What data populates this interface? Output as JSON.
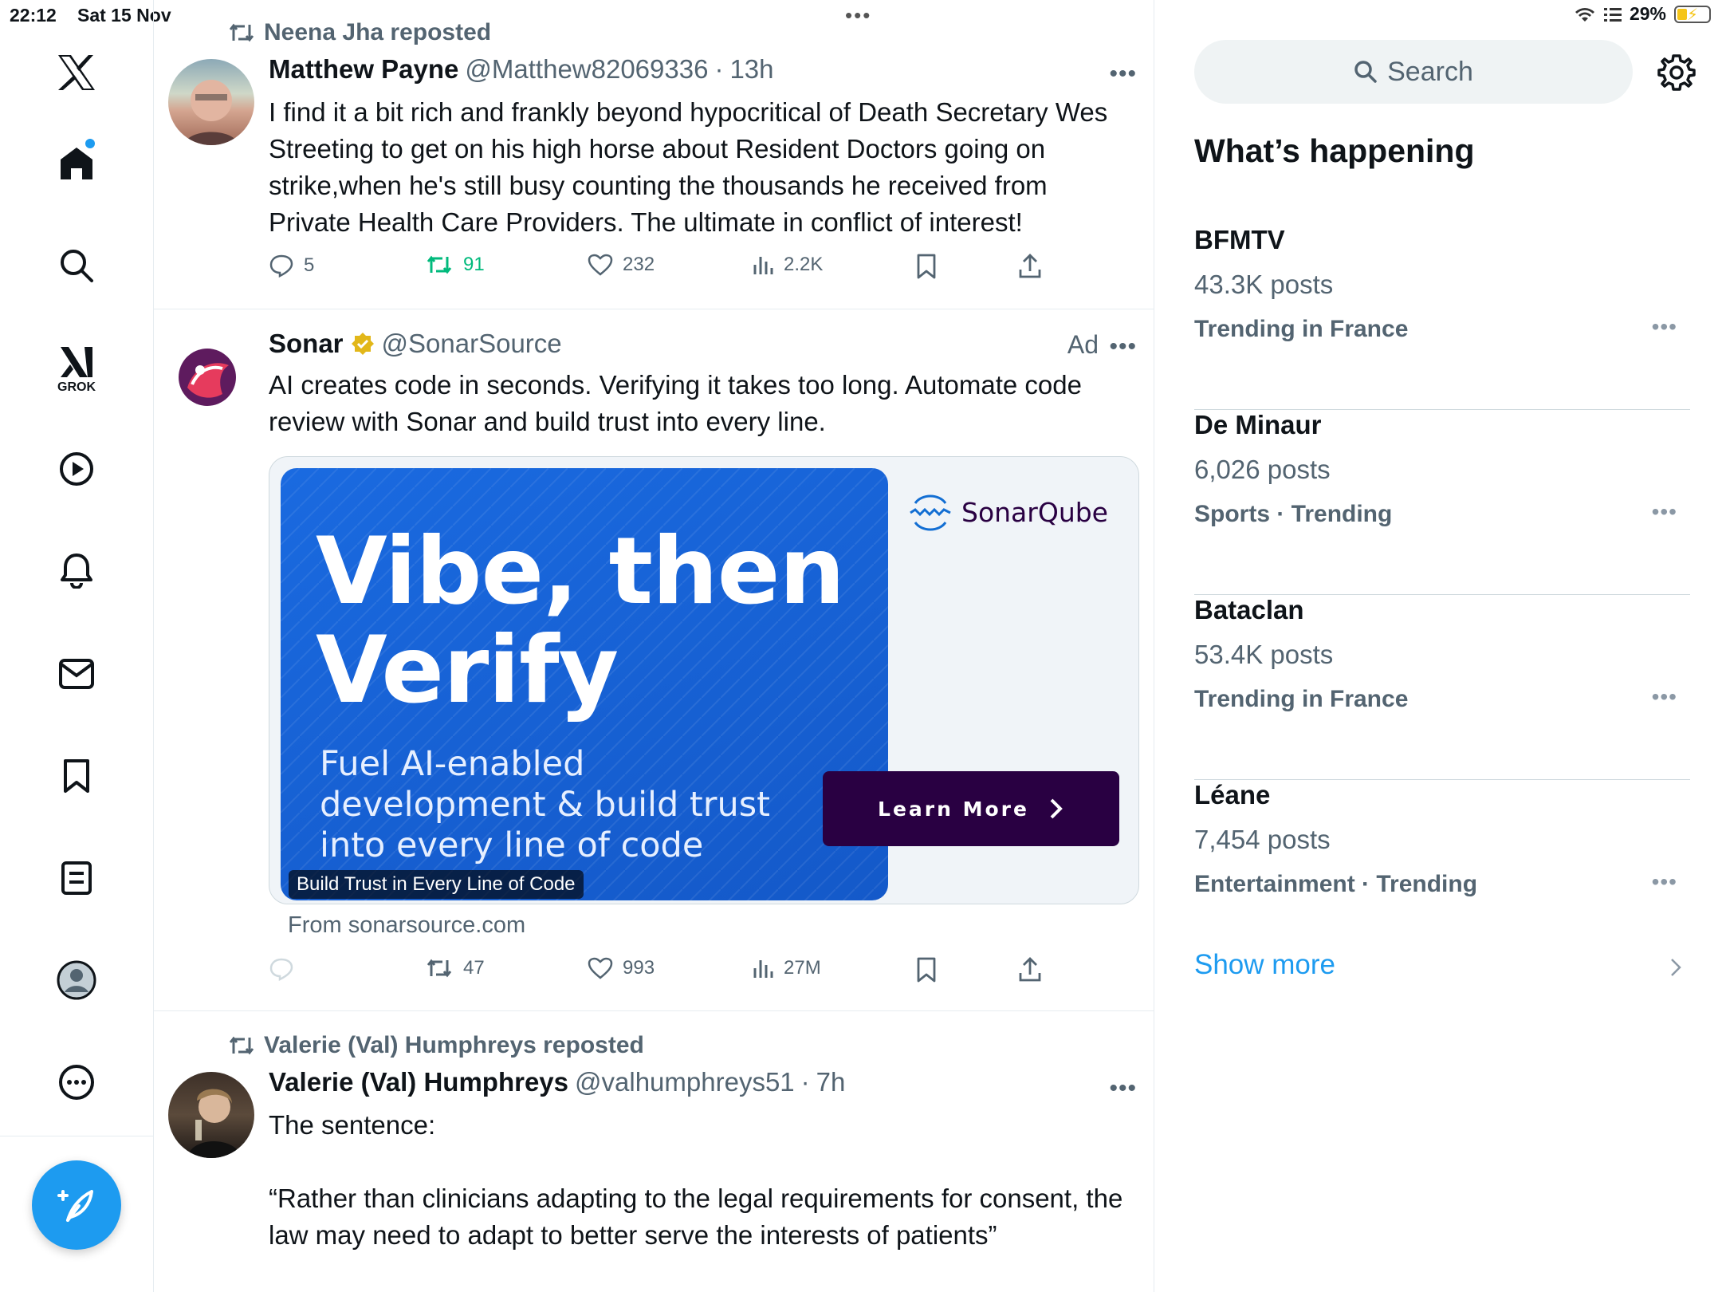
{
  "status_bar": {
    "time": "22:12",
    "date": "Sat 15 Nov",
    "battery": "29%"
  },
  "nav": {
    "items": [
      {
        "name": "x-logo"
      },
      {
        "name": "home"
      },
      {
        "name": "explore"
      },
      {
        "name": "grok",
        "label": "GROK"
      },
      {
        "name": "video"
      },
      {
        "name": "notifications"
      },
      {
        "name": "messages"
      },
      {
        "name": "bookmarks"
      },
      {
        "name": "lists"
      },
      {
        "name": "profile"
      },
      {
        "name": "more"
      }
    ],
    "compose_icon": "compose-icon"
  },
  "feed": {
    "posts": [
      {
        "reposted_by": "Neena Jha reposted",
        "name": "Matthew Payne",
        "handle": "@Matthew82069336",
        "time": "13h",
        "text": "I find it a bit rich and frankly beyond hypocritical of Death Secretary Wes Streeting to get on his high horse about Resident Doctors going on strike,when he's still busy counting the thousands he received from Private Health Care Providers. The ultimate in conflict of interest!",
        "replies": "5",
        "reposts": "91",
        "likes": "232",
        "views": "2.2K"
      },
      {
        "name": "Sonar",
        "handle": "@SonarSource",
        "ad_label": "Ad",
        "text": "AI creates code in seconds. Verifying it takes too long. Automate code review with Sonar and build trust into every line.",
        "card": {
          "headline_1": "Vibe, then",
          "headline_2": "Verify",
          "subtext": "Fuel AI-enabled development & build trust into every line of code",
          "caption": "Build Trust in Every Line of Code",
          "brand": "SonarQube",
          "cta": "Learn More"
        },
        "from": "From sonarsource.com",
        "replies": "",
        "reposts": "47",
        "likes": "993",
        "views": "27M"
      },
      {
        "reposted_by": "Valerie (Val) Humphreys reposted",
        "name": "Valerie (Val) Humphreys",
        "handle": "@valhumphreys51",
        "time": "7h",
        "text_1": "The sentence:",
        "text_2": "“Rather than clinicians adapting to the legal requirements for consent, the law may need to adapt to better serve the interests of patients”"
      }
    ]
  },
  "sidebar": {
    "search_placeholder": "Search",
    "title": "What’s happening",
    "trends": [
      {
        "name": "BFMTV",
        "count": "43.3K posts",
        "context": "Trending in France"
      },
      {
        "name": "De Minaur",
        "count": "6,026 posts",
        "context": "Sports · Trending"
      },
      {
        "name": "Bataclan",
        "count": "53.4K posts",
        "context": "Trending in France"
      },
      {
        "name": "Léane",
        "count": "7,454 posts",
        "context": "Entertainment · Trending"
      }
    ],
    "show_more": "Show more"
  },
  "colors": {
    "accent": "#1d9bf0",
    "repost_active": "#00ba7c",
    "sonar_purple": "#290042",
    "ad_blue": "#1a6ae0"
  }
}
